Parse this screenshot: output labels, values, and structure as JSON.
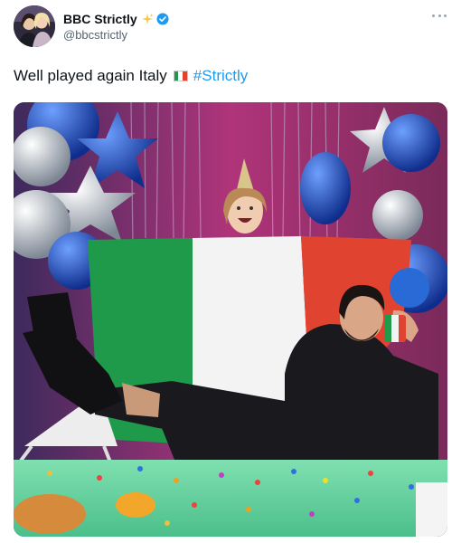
{
  "tweet": {
    "author": {
      "display_name": "BBC Strictly",
      "handle": "@bbcstrictly",
      "verified": true,
      "name_emoji": "sparkles-icon"
    },
    "text": "Well played again Italy",
    "flag_emoji": "italy-flag-icon",
    "hashtag": "#Strictly",
    "more_menu": "more-options-icon",
    "photo": {
      "description_icon": "party-photo-image",
      "flag_colors": [
        "#1f9a4a",
        "#f3f3f3",
        "#e0432f"
      ]
    },
    "colors": {
      "hashtag": "#1d9bf0",
      "verified": "#1d9bf0",
      "handle": "#536471"
    }
  }
}
